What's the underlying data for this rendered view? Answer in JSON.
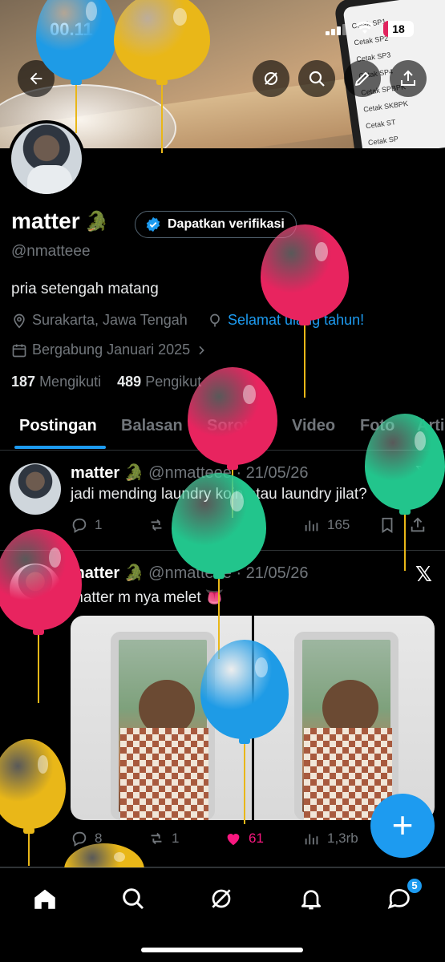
{
  "status_bar": {
    "time": "00.11",
    "battery": "18"
  },
  "banner": {
    "phone_lines": [
      "Cetak SP1",
      "Cetak SP2",
      "Cetak SP3",
      "Cetak SP4",
      "Cetak SPBPK",
      "Cetak SKBPK",
      "Cetak ST",
      "Cetak SP"
    ]
  },
  "profile": {
    "name": "matter",
    "emoji": "🐊",
    "verify_label": "Dapatkan verifikasi",
    "handle": "@nmatteee",
    "bio": "pria setengah matang",
    "location": "Surakarta, Jawa Tengah",
    "birthday": "Selamat ulang tahun!",
    "joined": "Bergabung Januari 2025",
    "following_count": "187",
    "following_label": "Mengikuti",
    "followers_count": "489",
    "followers_label": "Pengikut"
  },
  "tabs": [
    "Postingan",
    "Balasan",
    "Sorotan",
    "Video",
    "Foto",
    "Artikel"
  ],
  "posts": [
    {
      "name": "matter",
      "emoji": "🐊",
      "handle": "@nmatteee",
      "date": "· 21/05/26",
      "text": "jadi mending laundry koin atau laundry jilat?",
      "replies": "1",
      "reposts": "",
      "likes": "",
      "views": "165"
    },
    {
      "name": "matter",
      "emoji": "🐊",
      "handle": "@nmatteee",
      "date": "· 21/05/26",
      "text": "matter m nya melet 👅",
      "replies": "8",
      "reposts": "1",
      "likes": "61",
      "views": "1,3rb"
    }
  ],
  "fab_label": "+",
  "nav": {
    "messages_badge": "5"
  },
  "colors": {
    "accent": "#1d9bf0",
    "like": "#f91880",
    "balloon_red": "#e8245f",
    "balloon_green": "#22c58c",
    "balloon_yellow": "#e9b718",
    "balloon_blue": "#1e9be6"
  }
}
